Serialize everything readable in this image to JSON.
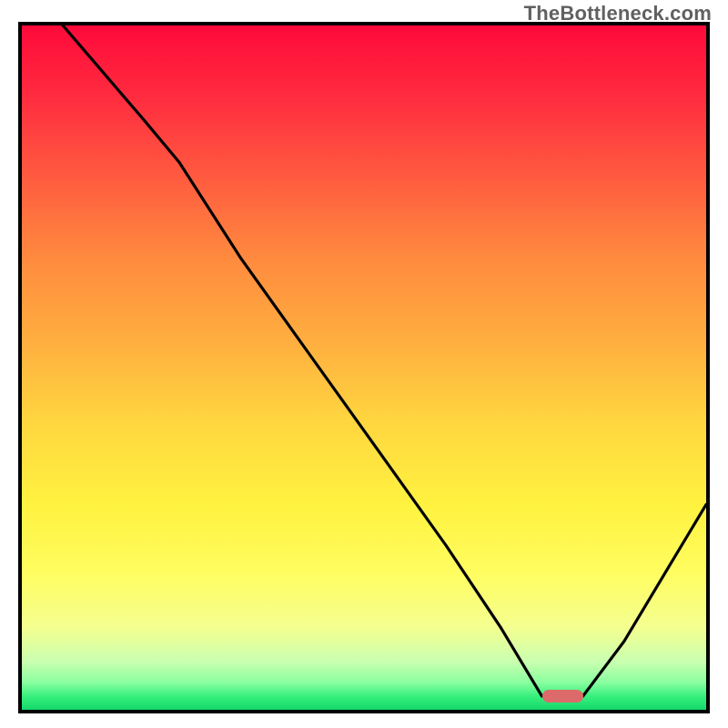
{
  "watermark": "TheBottleneck.com",
  "colors": {
    "border": "#000000",
    "curve": "#000000",
    "minmarker": "#dd6a6a",
    "gradient_top": "#ff0a3a",
    "gradient_mid": "#ffd63f",
    "gradient_bottom": "#14d86a"
  },
  "chart_data": {
    "type": "line",
    "title": "",
    "xlabel": "",
    "ylabel": "",
    "xlim": [
      0,
      100
    ],
    "ylim": [
      0,
      100
    ],
    "grid": false,
    "legend": false,
    "note": "Gradient-filled plot; black curve descends from top-left, kinks around x≈23, falls to a flat minimum near x≈76-82 at y≈2, then rises toward the right. A pink lozenge marks the minimum segment.",
    "series": [
      {
        "name": "bottleneck-curve",
        "x": [
          6,
          12,
          18,
          23,
          32,
          42,
          52,
          62,
          70,
          76,
          82,
          88,
          94,
          100
        ],
        "y": [
          100,
          93,
          86,
          80,
          66,
          52,
          38,
          24,
          12,
          2,
          2,
          10,
          20,
          30
        ]
      }
    ],
    "min_marker": {
      "x_from": 76,
      "x_to": 82,
      "y": 2
    }
  }
}
